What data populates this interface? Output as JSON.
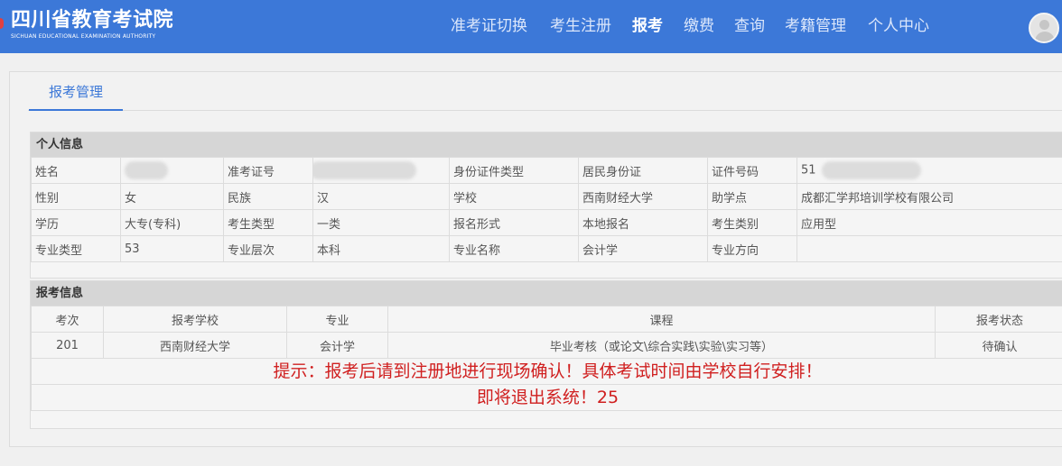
{
  "header": {
    "logo_cn": "四川省教育考试院",
    "logo_en": "SICHUAN EDUCATIONAL EXAMINATION AUTHORITY",
    "nav": [
      {
        "label": "准考证切换",
        "active": false
      },
      {
        "label": "考生注册",
        "active": false
      },
      {
        "label": "报考",
        "active": true
      },
      {
        "label": "缴费",
        "active": false
      },
      {
        "label": "查询",
        "active": false
      },
      {
        "label": "考籍管理",
        "active": false
      },
      {
        "label": "个人中心",
        "active": false
      }
    ]
  },
  "page": {
    "tab": "报考管理"
  },
  "personal": {
    "title": "个人信息",
    "rows": [
      [
        {
          "label": "姓名",
          "value": "",
          "redacted": true
        },
        {
          "label": "准考证号",
          "value": "",
          "redacted": true
        },
        {
          "label": "身份证件类型",
          "value": "居民身份证"
        },
        {
          "label": "证件号码",
          "value": "51",
          "redacted": true
        }
      ],
      [
        {
          "label": "性别",
          "value": "女"
        },
        {
          "label": "民族",
          "value": "汉"
        },
        {
          "label": "学校",
          "value": "西南财经大学"
        },
        {
          "label": "助学点",
          "value": "成都汇学邦培训学校有限公司"
        }
      ],
      [
        {
          "label": "学历",
          "value": "大专(专科)"
        },
        {
          "label": "考生类型",
          "value": "一类"
        },
        {
          "label": "报名形式",
          "value": "本地报名"
        },
        {
          "label": "考生类别",
          "value": "应用型"
        }
      ],
      [
        {
          "label": "专业类型",
          "value": "53"
        },
        {
          "label": "专业层次",
          "value": "本科"
        },
        {
          "label": "专业名称",
          "value": "会计学"
        },
        {
          "label": "专业方向",
          "value": ""
        }
      ]
    ]
  },
  "apply": {
    "title": "报考信息",
    "headers": [
      "考次",
      "报考学校",
      "专业",
      "课程",
      "报考状态"
    ],
    "rows": [
      [
        "201",
        "西南财经大学",
        "会计学",
        "毕业考核（或论文\\综合实践\\实验\\实习等）",
        "待确认"
      ]
    ],
    "notice_line1": "提示：报考后请到注册地进行现场确认！具体考试时间由学校自行安排！",
    "notice_line2": "即将退出系统！25"
  },
  "colors": {
    "header_bg": "#3c78d8",
    "tab_accent": "#3c78d8",
    "notice": "#d02020"
  }
}
